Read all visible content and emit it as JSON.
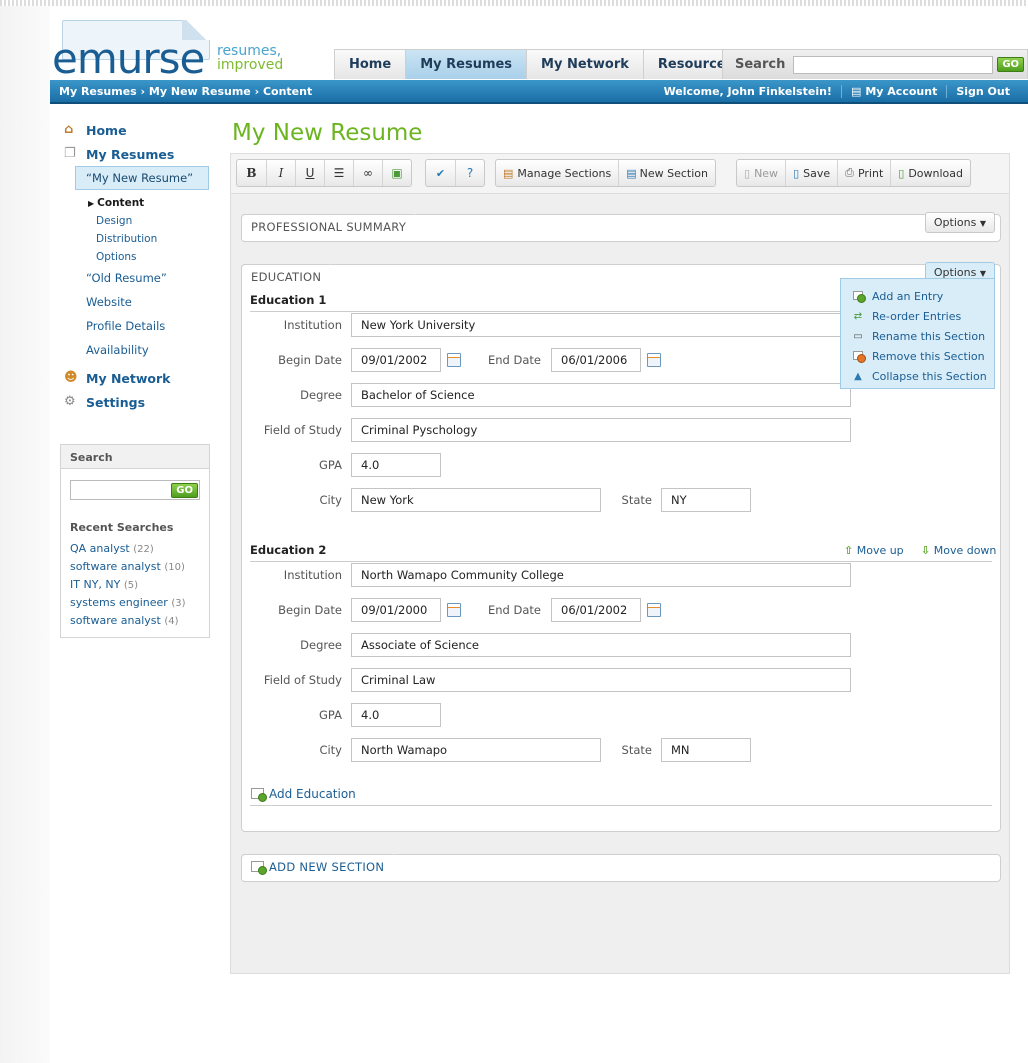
{
  "logo": {
    "word": "emurse",
    "tag_line1": "resumes,",
    "tag_line2": "improved"
  },
  "nav": {
    "tabs": [
      "Home",
      "My Resumes",
      "My Network",
      "Resources"
    ],
    "active_tab": "My Resumes",
    "search_label": "Search",
    "go_label": "GO"
  },
  "bluebar": {
    "breadcrumb": "My Resumes › My New Resume › Content",
    "welcome": "Welcome, John Finkelstein!",
    "account": "My Account",
    "signout": "Sign Out"
  },
  "sidebar": {
    "home": "Home",
    "my_resumes": "My Resumes",
    "resume_selected": "“My New Resume”",
    "sub": [
      "Content",
      "Design",
      "Distribution",
      "Options"
    ],
    "current_sub": "Content",
    "other_items": [
      "“Old Resume”",
      "Website",
      "Profile Details",
      "Availability"
    ],
    "my_network": "My Network",
    "settings": "Settings"
  },
  "side_search": {
    "title": "Search",
    "go_label": "GO",
    "recent_title": "Recent Searches",
    "recent": [
      {
        "term": "QA analyst",
        "count": "(22)"
      },
      {
        "term": "software analyst",
        "count": "(10)"
      },
      {
        "term": "IT NY, NY",
        "count": "(5)"
      },
      {
        "term": "systems engineer",
        "count": "(3)"
      },
      {
        "term": "software analyst",
        "count": "(4)"
      }
    ]
  },
  "page_title": "My New Resume",
  "toolbar": {
    "bold": "B",
    "italic": "I",
    "underline": "U",
    "manage_sections": "Manage Sections",
    "new_section": "New Section",
    "new": "New",
    "save": "Save",
    "print": "Print",
    "download": "Download"
  },
  "sections": {
    "professional_summary": "PROFESSIONAL SUMMARY",
    "education": "EDUCATION",
    "options_label": "Options",
    "add_new_section": "ADD NEW SECTION"
  },
  "options_menu": [
    "Add an Entry",
    "Re-order Entries",
    "Rename this Section",
    "Remove this Section",
    "Collapse this Section"
  ],
  "labels": {
    "institution": "Institution",
    "begin_date": "Begin Date",
    "end_date": "End Date",
    "degree": "Degree",
    "field_of_study": "Field of Study",
    "gpa": "GPA",
    "city": "City",
    "state": "State",
    "move_up": "Move up",
    "move_down": "Move down",
    "add_education": "Add Education"
  },
  "education": [
    {
      "heading": "Education 1",
      "institution": "New York University",
      "begin_date": "09/01/2002",
      "end_date": "06/01/2006",
      "degree": "Bachelor of Science",
      "field_of_study": "Criminal Pyschology",
      "gpa": "4.0",
      "city": "New York",
      "state": "NY"
    },
    {
      "heading": "Education 2",
      "institution": "North Wamapo Community College",
      "begin_date": "09/01/2000",
      "end_date": "06/01/2002",
      "degree": "Associate of Science",
      "field_of_study": "Criminal Law",
      "gpa": "4.0",
      "city": "North Wamapo",
      "state": "MN"
    }
  ],
  "colors": {
    "brand_blue": "#1a5d93",
    "brand_green": "#6cb521",
    "bar_blue": "#1a6ea6"
  }
}
